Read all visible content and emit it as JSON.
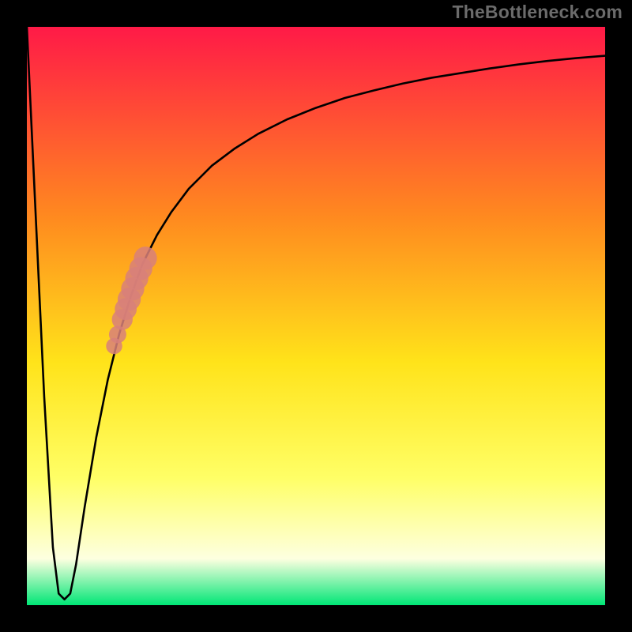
{
  "watermark": "TheBottleneck.com",
  "colors": {
    "frame": "#000000",
    "curve": "#000000",
    "marker": "#d8807a",
    "gradient_top": "#ff1a47",
    "gradient_mid_upper": "#ff8a1f",
    "gradient_mid": "#ffe31a",
    "gradient_mid_lower": "#ffff66",
    "gradient_near_bottom": "#fdffe0",
    "gradient_bottom": "#00e676"
  },
  "chart_data": {
    "type": "line",
    "title": "",
    "xlabel": "",
    "ylabel": "",
    "xlim": [
      0,
      100
    ],
    "ylim": [
      0,
      100
    ],
    "grid": false,
    "legend": false,
    "series": [
      {
        "name": "curve",
        "x": [
          0.0,
          1.5,
          3.0,
          4.5,
          5.5,
          6.5,
          7.5,
          8.5,
          10.0,
          12.0,
          14.0,
          16.0,
          18.0,
          20.0,
          22.5,
          25.0,
          28.0,
          32.0,
          36.0,
          40.0,
          45.0,
          50.0,
          55.0,
          60.0,
          65.0,
          70.0,
          75.0,
          80.0,
          85.0,
          90.0,
          95.0,
          100.0
        ],
        "y": [
          100.0,
          68.0,
          36.0,
          10.0,
          2.0,
          1.0,
          2.0,
          7.0,
          17.0,
          29.0,
          39.0,
          47.0,
          53.5,
          59.0,
          64.0,
          68.0,
          72.0,
          76.0,
          79.0,
          81.5,
          84.0,
          86.0,
          87.7,
          89.0,
          90.2,
          91.2,
          92.0,
          92.8,
          93.5,
          94.1,
          94.6,
          95.0
        ]
      }
    ],
    "markers": [
      {
        "name": "upper-highlight-top",
        "x": 20.5,
        "y": 60.0,
        "r": 2.0
      },
      {
        "name": "upper-highlight-a",
        "x": 19.7,
        "y": 58.2,
        "r": 2.0
      },
      {
        "name": "upper-highlight-b",
        "x": 19.0,
        "y": 56.5,
        "r": 2.0
      },
      {
        "name": "upper-highlight-c",
        "x": 18.3,
        "y": 54.7,
        "r": 2.0
      },
      {
        "name": "upper-highlight-d",
        "x": 17.7,
        "y": 52.9,
        "r": 2.0
      },
      {
        "name": "upper-highlight-e",
        "x": 17.1,
        "y": 51.2,
        "r": 1.9
      },
      {
        "name": "upper-highlight-f",
        "x": 16.5,
        "y": 49.4,
        "r": 1.8
      },
      {
        "name": "lower-highlight-top",
        "x": 15.7,
        "y": 46.8,
        "r": 1.5
      },
      {
        "name": "lower-highlight-bottom",
        "x": 15.1,
        "y": 44.8,
        "r": 1.4
      }
    ]
  }
}
